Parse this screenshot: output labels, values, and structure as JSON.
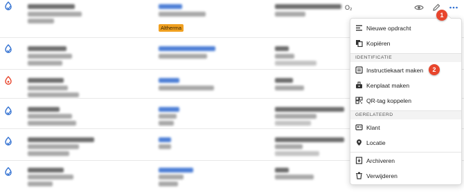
{
  "row1": {
    "badge": "Altherma",
    "o2_text": "O₂"
  },
  "menu": {
    "items": [
      {
        "label": "Nieuwe opdracht",
        "icon": "list-icon"
      },
      {
        "label": "Kopiëren",
        "icon": "copy-icon"
      }
    ],
    "sections": [
      {
        "title": "IDENTIFICATIE",
        "items": [
          {
            "label": "Instructiekaart maken",
            "icon": "instruction-card-icon"
          },
          {
            "label": "Kenplaat maken",
            "icon": "nameplate-icon"
          },
          {
            "label": "QR-tag koppelen",
            "icon": "qr-code-icon"
          }
        ]
      },
      {
        "title": "GERELATEERD",
        "items": [
          {
            "label": "Klant",
            "icon": "customer-card-icon"
          },
          {
            "label": "Locatie",
            "icon": "location-pin-icon"
          }
        ]
      }
    ],
    "bottom_items": [
      {
        "label": "Archiveren",
        "icon": "archive-icon"
      },
      {
        "label": "Verwijderen",
        "icon": "trash-icon"
      }
    ]
  },
  "markers": {
    "step1": "1",
    "step2": "2"
  },
  "colors": {
    "accent_blue": "#2f6fd1",
    "marker_red": "#e8452c",
    "badge_orange": "#f0a020"
  }
}
